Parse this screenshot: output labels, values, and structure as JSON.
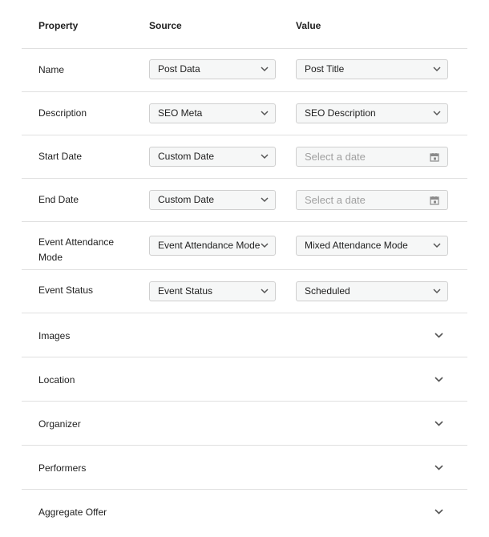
{
  "header": {
    "property": "Property",
    "source": "Source",
    "value": "Value"
  },
  "rows": [
    {
      "label": "Name",
      "source": "Post Data",
      "value": "Post Title"
    },
    {
      "label": "Description",
      "source": "SEO Meta",
      "value": "SEO Description"
    },
    {
      "label": "Start Date",
      "source": "Custom Date",
      "value_placeholder": "Select a date"
    },
    {
      "label": "End Date",
      "source": "Custom Date",
      "value_placeholder": "Select a date"
    },
    {
      "label": "Event Attendance Mode",
      "source": "Event Attendance Mode",
      "value": "Mixed Attendance Mode"
    },
    {
      "label": "Event Status",
      "source": "Event Status",
      "value": "Scheduled"
    }
  ],
  "sections": [
    {
      "label": "Images"
    },
    {
      "label": "Location"
    },
    {
      "label": "Organizer"
    },
    {
      "label": "Performers"
    },
    {
      "label": "Aggregate Offer"
    }
  ],
  "icons": {
    "dropdown": "chevron-down-icon",
    "calendar": "calendar-icon"
  },
  "colors": {
    "border": "#e0e0e0",
    "select_bg": "#f6f7f7",
    "placeholder": "#a0a0a0"
  }
}
